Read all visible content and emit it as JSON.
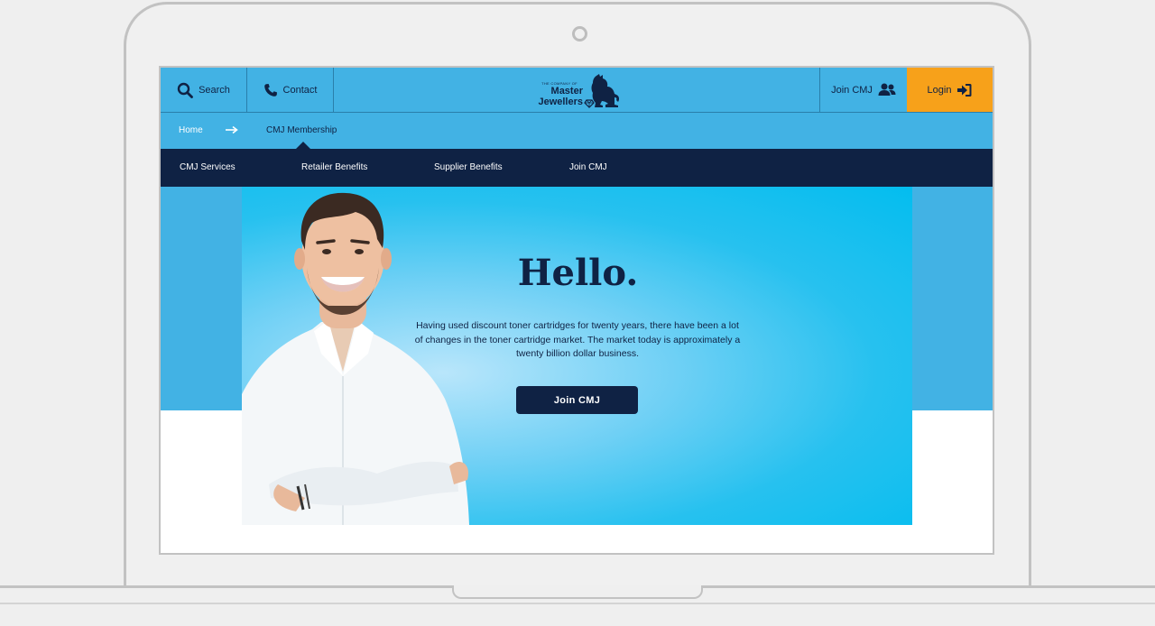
{
  "topbar": {
    "search_label": "Search",
    "contact_label": "Contact",
    "join_label": "Join CMJ",
    "login_label": "Login",
    "login_color": "#f7a11a"
  },
  "logo": {
    "small_text": "THE COMPANY OF",
    "line1": "Master",
    "line2": "Jewellers"
  },
  "breadcrumb": {
    "home": "Home",
    "current": "CMJ Membership"
  },
  "subnav": {
    "items": [
      "CMJ Services",
      "Retailer Benefits",
      "Supplier Benefits",
      "Join CMJ"
    ]
  },
  "hero": {
    "title": "Hello.",
    "description": "Having used discount toner cartridges for twenty years, there have been a lot of changes in the toner cartridge market. The market today is approximately a twenty billion dollar business.",
    "button_label": "Join CMJ"
  },
  "colors": {
    "brand_blue": "#42b2e4",
    "navy": "#0f2244",
    "hero_cyan": "#03bdef"
  },
  "icons": [
    "search-icon",
    "phone-icon",
    "users-icon",
    "login-icon",
    "lion-logo-icon",
    "arrow-right-icon"
  ]
}
